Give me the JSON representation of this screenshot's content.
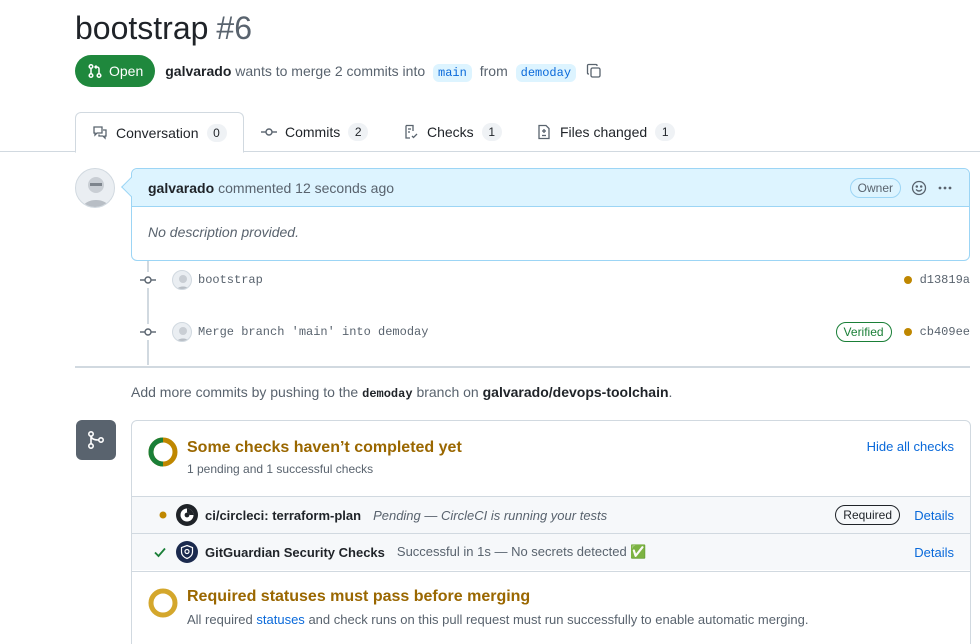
{
  "pr": {
    "title": "bootstrap",
    "number": "#6",
    "state": "Open",
    "author": "galvarado",
    "merge_text": "wants to merge 2 commits into",
    "base_branch": "main",
    "from_text": "from",
    "head_branch": "demoday"
  },
  "tabs": [
    {
      "label": "Conversation",
      "count": "0",
      "icon": "comment-discussion-icon"
    },
    {
      "label": "Commits",
      "count": "2",
      "icon": "git-commit-icon"
    },
    {
      "label": "Checks",
      "count": "1",
      "icon": "checklist-icon"
    },
    {
      "label": "Files changed",
      "count": "1",
      "icon": "file-diff-icon"
    }
  ],
  "comment": {
    "author": "galvarado",
    "action": "commented 12 seconds ago",
    "role_label": "Owner",
    "body": "No description provided."
  },
  "commits": [
    {
      "message": "bootstrap",
      "sha": "d13819a",
      "verified": ""
    },
    {
      "message": "Merge branch 'main' into demoday",
      "sha": "cb409ee",
      "verified": "Verified"
    }
  ],
  "hint": {
    "prefix": "Add more commits by pushing to the",
    "branch": "demoday",
    "middle": "branch on",
    "repo": "galvarado/devops-toolchain",
    "suffix": "."
  },
  "checks": {
    "title": "Some checks haven’t completed yet",
    "subtitle": "1 pending and 1 successful checks",
    "hide_link": "Hide all checks",
    "items": [
      {
        "name": "ci/circleci: terraform-plan",
        "description": "Pending — CircleCI is running your tests",
        "badge": "Required",
        "details": "Details",
        "status": "pending",
        "app_icon": "circleci-icon"
      },
      {
        "name": "GitGuardian Security Checks",
        "description": "Successful in 1s — No secrets detected ✅",
        "badge": "",
        "details": "Details",
        "status": "success",
        "app_icon": "gitguardian-icon"
      }
    ]
  },
  "required": {
    "title": "Required statuses must pass before merging",
    "sub_prefix": "All required",
    "sub_link": "statuses",
    "sub_suffix": "and check runs on this pull request must run successfully to enable automatic merging."
  },
  "colors": {
    "open_green": "#1f883d",
    "link_blue": "#0969da",
    "pending_yellow": "#bf8700",
    "success_green": "#1a7f37",
    "comment_header_blue": "#ddf4ff"
  }
}
